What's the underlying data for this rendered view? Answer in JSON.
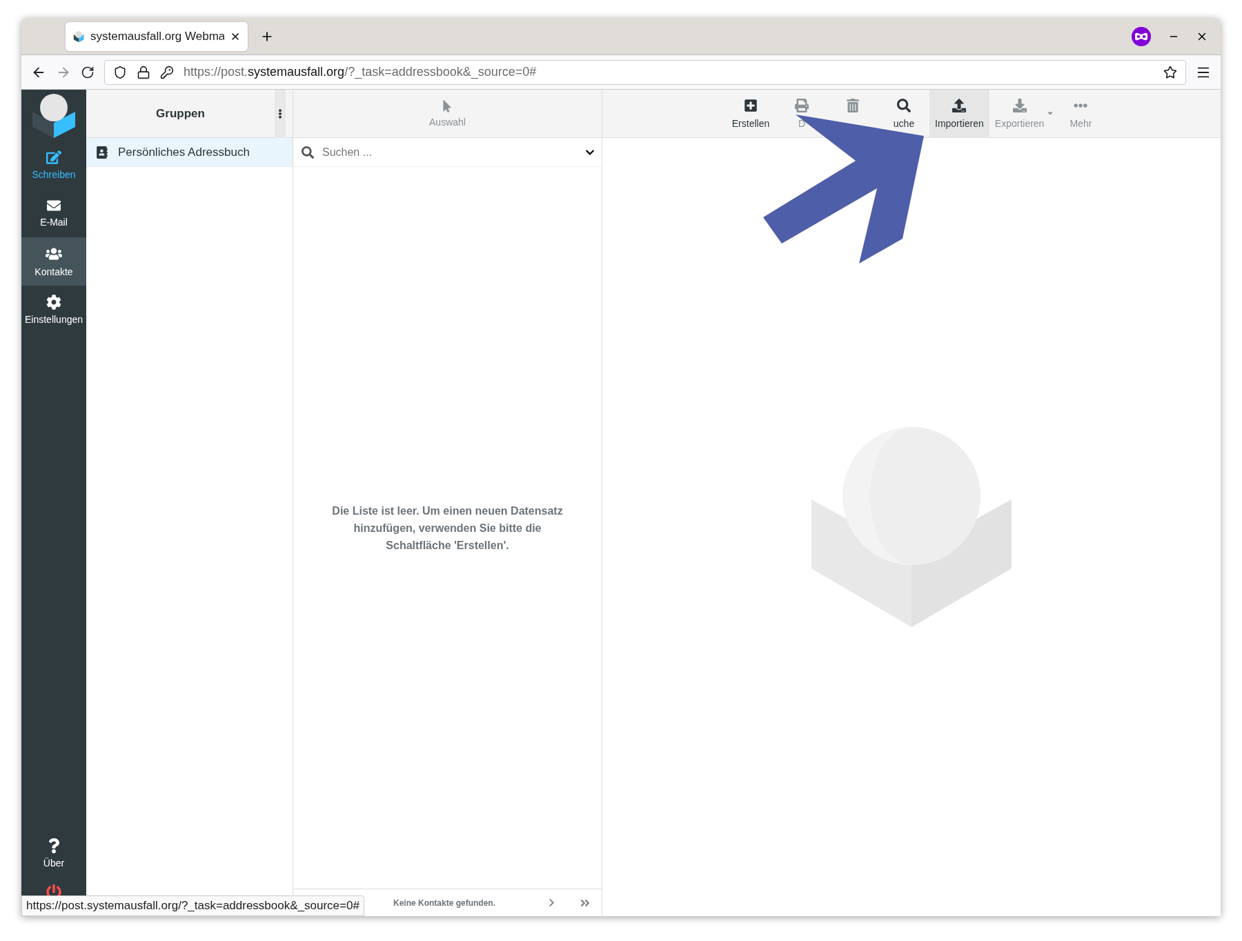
{
  "browser": {
    "tab_title": "systemausfall.org Webma",
    "url": "https://post.**systemausfall.org**/?_task=addressbook&_source=0#",
    "private": true
  },
  "sidebar": {
    "items": [
      {
        "kind": "compose",
        "label": "Schreiben",
        "selected": false
      },
      {
        "kind": "mail",
        "label": "E-Mail",
        "selected": false
      },
      {
        "kind": "contacts",
        "label": "Kontakte",
        "selected": true
      },
      {
        "kind": "settings",
        "label": "Einstellungen",
        "selected": false
      }
    ],
    "bottom_items": [
      {
        "kind": "about",
        "label": "Über"
      },
      {
        "kind": "logout"
      }
    ]
  },
  "groups": {
    "title": "Gruppen",
    "items": [
      {
        "label": "Persönliches Adressbuch",
        "selected": true
      }
    ]
  },
  "list": {
    "header": {
      "label": "Auswahl",
      "disabled": true
    },
    "search": {
      "placeholder": "Suchen ..."
    },
    "empty_message": "Die Liste ist leer. Um einen neuen Datensatz hinzufügen, verwenden Sie bitte die Schaltfläche 'Erstellen'.",
    "footer": "Keine Kontakte gefunden."
  },
  "toolbar": [
    {
      "kind": "create",
      "label": "Erstellen",
      "disabled": false,
      "selected": false
    },
    {
      "kind": "print",
      "label": "D",
      "disabled": true,
      "selected": false
    },
    {
      "kind": "delete",
      "disabled": true,
      "selected": false
    },
    {
      "kind": "search",
      "label": "uche",
      "disabled": false,
      "selected": false
    },
    {
      "kind": "import",
      "label": "Importieren",
      "disabled": false,
      "selected": true
    },
    {
      "kind": "export",
      "label": "Exportieren",
      "disabled": true,
      "selected": false,
      "dropdown": true
    },
    {
      "kind": "more",
      "label": "Mehr",
      "disabled": true,
      "selected": false
    }
  ],
  "status_url": "https://post.systemausfall.org/?_task=addressbook&_source=0#"
}
